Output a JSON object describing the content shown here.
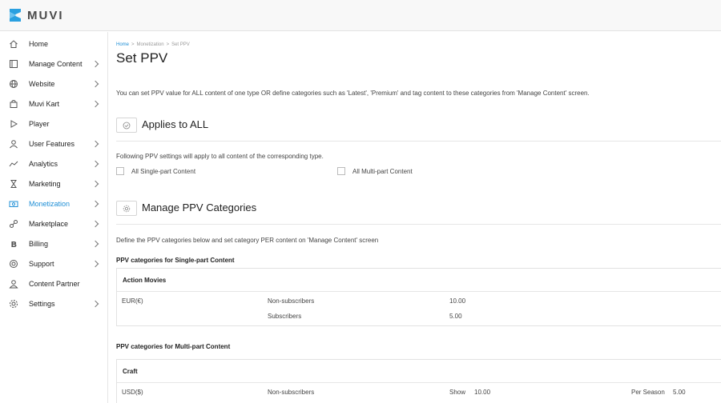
{
  "brand": {
    "name": "MUVI"
  },
  "sidebar": {
    "items": [
      {
        "label": "Home",
        "icon": "home-icon",
        "chevron": false
      },
      {
        "label": "Manage Content",
        "icon": "content-icon",
        "chevron": true
      },
      {
        "label": "Website",
        "icon": "globe-icon",
        "chevron": true
      },
      {
        "label": "Muvi Kart",
        "icon": "bag-icon",
        "chevron": true
      },
      {
        "label": "Player",
        "icon": "play-icon",
        "chevron": false
      },
      {
        "label": "User Features",
        "icon": "user-icon",
        "chevron": true
      },
      {
        "label": "Analytics",
        "icon": "analytics-icon",
        "chevron": true
      },
      {
        "label": "Marketing",
        "icon": "hourglass-icon",
        "chevron": true
      },
      {
        "label": "Monetization",
        "icon": "money-icon",
        "chevron": true,
        "active": true
      },
      {
        "label": "Marketplace",
        "icon": "link-icon",
        "chevron": true
      },
      {
        "label": "Billing",
        "icon": "bitcoin-icon",
        "chevron": true
      },
      {
        "label": "Support",
        "icon": "support-icon",
        "chevron": true
      },
      {
        "label": "Content Partner",
        "icon": "partner-icon",
        "chevron": false
      },
      {
        "label": "Settings",
        "icon": "gear-icon",
        "chevron": true
      }
    ]
  },
  "breadcrumb": {
    "home": "Home",
    "section": "Monetization",
    "current": "Set PPV"
  },
  "page": {
    "title": "Set PPV",
    "intro": "You can set PPV value for ALL content of one type OR define categories such as 'Latest', 'Premium' and tag content to these categories from 'Manage Content' screen."
  },
  "applies_all": {
    "title": "Applies to ALL",
    "description": "Following PPV settings will apply to all content of the corresponding type.",
    "options": [
      "All Single-part Content",
      "All Multi-part Content"
    ]
  },
  "manage_categories": {
    "title": "Manage PPV Categories",
    "description": "Define the PPV categories below and set category PER content on 'Manage Content' screen",
    "single_part": {
      "heading": "PPV categories for Single-part Content",
      "category": "Action Movies",
      "currency": "EUR(€)",
      "rows": [
        {
          "audience": "Non-subscribers",
          "price": "10.00"
        },
        {
          "audience": "Subscribers",
          "price": "5.00"
        }
      ]
    },
    "multi_part": {
      "heading": "PPV categories for Multi-part Content",
      "category": "Craft",
      "currency": "USD($)",
      "row": {
        "audience": "Non-subscribers",
        "show_label": "Show",
        "show_price": "10.00",
        "season_label": "Per Season",
        "season_price": "5.00"
      }
    }
  },
  "colors": {
    "accent": "#1f8fd6",
    "logo": "#2aa0e0"
  }
}
